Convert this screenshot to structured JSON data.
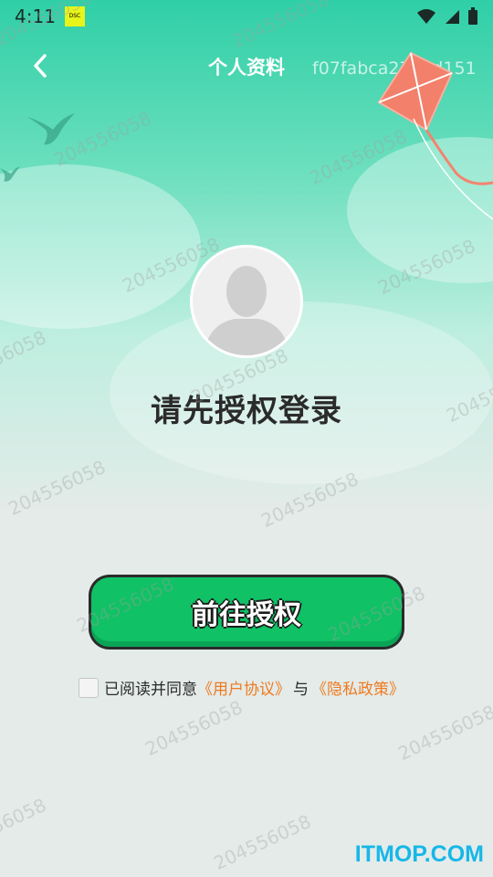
{
  "status_bar": {
    "time": "4:11"
  },
  "header": {
    "title": "个人资料"
  },
  "overlay_hash": "f07fabca276ed151",
  "main": {
    "prompt": "请先授权登录",
    "auth_button": "前往授权",
    "agreement": {
      "prefix": "已阅读并同意",
      "user_agreement": "《用户协议》",
      "and": "与",
      "privacy_policy": "《隐私政策》"
    }
  },
  "watermark": "204556058",
  "footer": {
    "brand": "ITMOP.COM"
  },
  "colors": {
    "accent_green": "#10c165",
    "link_orange": "#f07a1f",
    "brand_blue": "#17b7e8"
  }
}
